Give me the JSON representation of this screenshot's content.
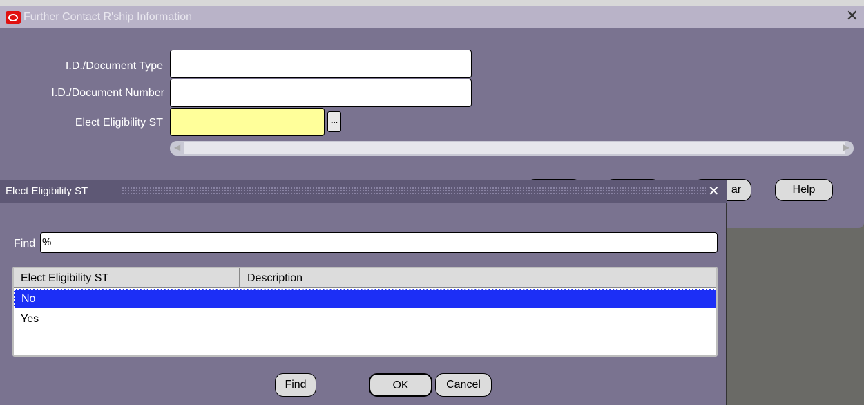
{
  "window": {
    "title": "Further Contact R'ship Information",
    "close_glyph": "✕"
  },
  "fields": {
    "doc_type_label": "I.D./Document Type",
    "doc_type_value": "",
    "doc_number_label": "I.D./Document Number",
    "doc_number_value": "",
    "elect_label": "Elect Eligibility ST",
    "elect_value": "",
    "lov_glyph": "..."
  },
  "window_buttons": {
    "clear_partial": "ar",
    "help_label": "Help"
  },
  "lov": {
    "title": "Elect Eligibility ST",
    "close_glyph": "✕",
    "find_label": "Find",
    "find_value": "%",
    "columns": [
      "Elect Eligibility ST",
      "Description"
    ],
    "rows": [
      {
        "value": "No",
        "description": "",
        "selected": true
      },
      {
        "value": "Yes",
        "description": "",
        "selected": false
      }
    ],
    "buttons": {
      "find": "Find",
      "ok": "OK",
      "cancel": "Cancel"
    }
  },
  "colors": {
    "window_bg": "#7a7390",
    "selection": "#1c2ff6",
    "required_field": "#ffff9a"
  }
}
